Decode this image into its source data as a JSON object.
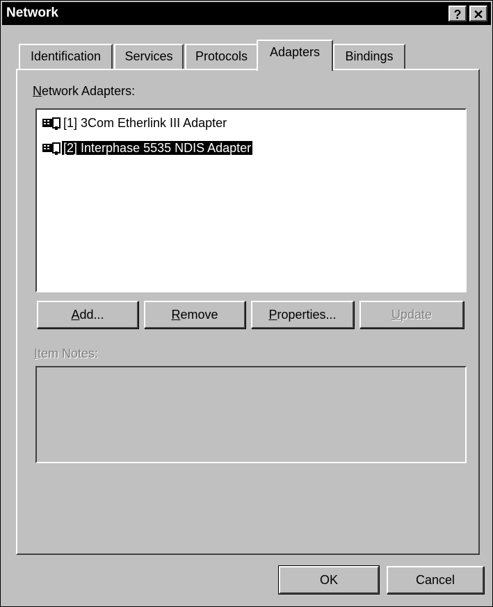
{
  "window": {
    "title": "Network",
    "help_button": "?",
    "close_button": "✕"
  },
  "tabs": [
    {
      "label": "Identification",
      "active": false
    },
    {
      "label": "Services",
      "active": false
    },
    {
      "label": "Protocols",
      "active": false
    },
    {
      "label": "Adapters",
      "active": true
    },
    {
      "label": "Bindings",
      "active": false
    }
  ],
  "adapters_panel": {
    "network_adapters_label": "Network Adapters:",
    "adapters": [
      {
        "label": "[1] 3Com Etherlink III Adapter",
        "icon": "network-card-icon",
        "selected": false
      },
      {
        "label": "[2] Interphase 5535 NDIS Adapter",
        "icon": "network-card-icon",
        "selected": true
      }
    ],
    "buttons": {
      "add": "Add...",
      "remove": "Remove",
      "properties": "Properties...",
      "update": "Update"
    },
    "item_notes_label": "Item Notes:",
    "item_notes_value": ""
  },
  "footer": {
    "ok": "OK",
    "cancel": "Cancel"
  },
  "colors": {
    "face": "#c0c0c0",
    "titlebar": "#000000",
    "selection": "#000000",
    "disabled_text": "#808080"
  }
}
